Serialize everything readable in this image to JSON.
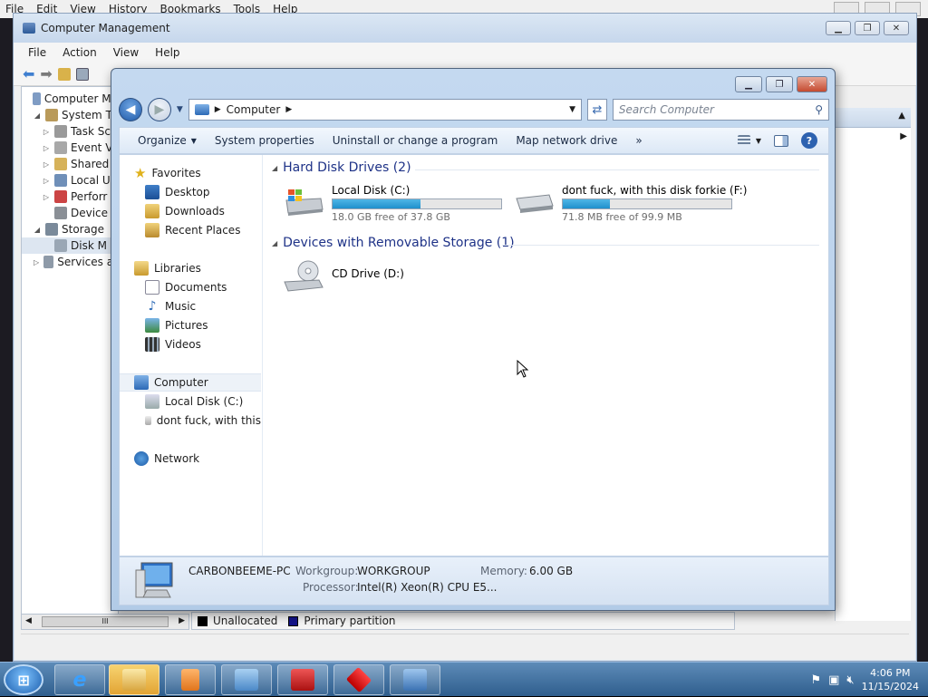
{
  "background_browser": {
    "menu": [
      "File",
      "Edit",
      "View",
      "History",
      "Bookmarks",
      "Tools",
      "Help"
    ]
  },
  "computer_management": {
    "title": "Computer Management",
    "menu": [
      "File",
      "Action",
      "View",
      "Help"
    ],
    "tree": [
      {
        "label": "Computer Ma",
        "indent": 0,
        "expander": ""
      },
      {
        "label": "System To",
        "indent": 1,
        "expander": "◢"
      },
      {
        "label": "Task Sc",
        "indent": 2,
        "expander": "▷"
      },
      {
        "label": "Event V",
        "indent": 2,
        "expander": "▷"
      },
      {
        "label": "Shared",
        "indent": 2,
        "expander": "▷"
      },
      {
        "label": "Local U",
        "indent": 2,
        "expander": "▷"
      },
      {
        "label": "Perforr",
        "indent": 2,
        "expander": "▷"
      },
      {
        "label": "Device",
        "indent": 2,
        "expander": ""
      },
      {
        "label": "Storage",
        "indent": 1,
        "expander": "◢"
      },
      {
        "label": "Disk M",
        "indent": 2,
        "expander": ""
      },
      {
        "label": "Services ar",
        "indent": 1,
        "expander": "▷"
      }
    ],
    "legend": [
      {
        "label": "Unallocated",
        "color": "#000000"
      },
      {
        "label": "Primary partition",
        "color": "#14148a"
      }
    ],
    "scroll_thumb_label": "III"
  },
  "explorer": {
    "address": "Computer",
    "search_placeholder": "Search Computer",
    "commands": [
      "Organize",
      "System properties",
      "Uninstall or change a program",
      "Map network drive",
      "»"
    ],
    "nav": {
      "favorites": "Favorites",
      "favorites_items": [
        "Desktop",
        "Downloads",
        "Recent Places"
      ],
      "libraries": "Libraries",
      "libraries_items": [
        "Documents",
        "Music",
        "Pictures",
        "Videos"
      ],
      "computer": "Computer",
      "computer_items": [
        "Local Disk (C:)",
        "dont fuck, with this"
      ],
      "network": "Network"
    },
    "groups": {
      "hdd": "Hard Disk Drives (2)",
      "removable": "Devices with Removable Storage (1)"
    },
    "drives": [
      {
        "name": "Local Disk (C:)",
        "free_text": "18.0 GB free of 37.8 GB",
        "used_fraction": 0.52
      },
      {
        "name": "dont fuck, with this disk forkie (F:)",
        "free_text": "71.8 MB free of 99.9 MB",
        "used_fraction": 0.28
      }
    ],
    "cd_drive": "CD Drive (D:)",
    "details": {
      "pc_name": "CARBONBEEME-PC",
      "workgroup_label": "Workgroup:",
      "workgroup": "WORKGROUP",
      "memory_label": "Memory:",
      "memory": "6.00 GB",
      "processor_label": "Processor:",
      "processor": "Intel(R) Xeon(R) CPU E5..."
    }
  },
  "taskbar": {
    "time": "4:06 PM",
    "date": "11/15/2024"
  }
}
